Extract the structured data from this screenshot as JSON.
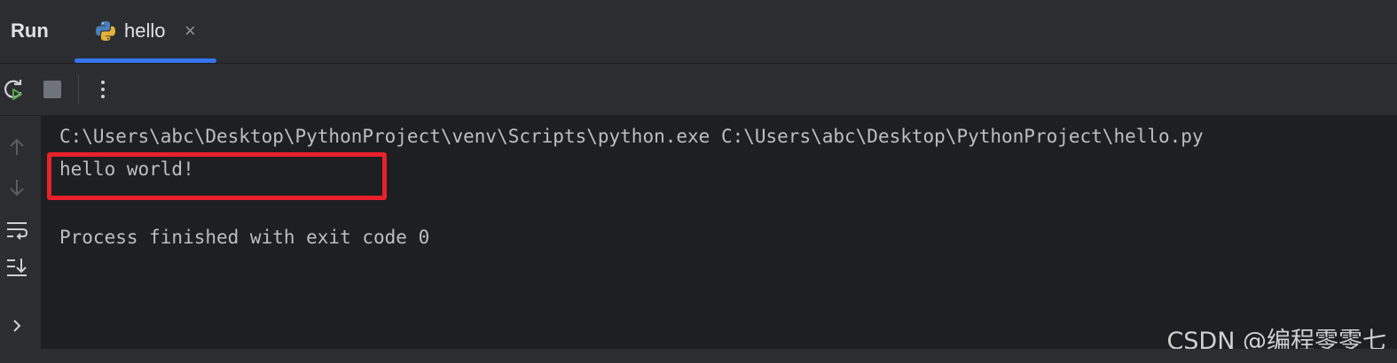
{
  "panel": {
    "title": "Run"
  },
  "tab": {
    "label": "hello",
    "close": "×",
    "icon": "python-icon"
  },
  "toolbar": {
    "rerun_icon": "rerun-icon",
    "stop_icon": "stop-icon",
    "more_icon": "more-vertical-icon"
  },
  "gutter": [
    "up-arrow-icon",
    "down-arrow-icon",
    "soft-wrap-icon",
    "scroll-to-end-icon",
    "chevron-right-icon"
  ],
  "console": {
    "command": "C:\\Users\\abc\\Desktop\\PythonProject\\venv\\Scripts\\python.exe C:\\Users\\abc\\Desktop\\PythonProject\\hello.py",
    "output": "hello world!",
    "exit": "Process finished with exit code 0"
  },
  "watermark": "CSDN @编程零零七",
  "colors": {
    "accent": "#3574f0",
    "highlight": "#e8212b",
    "console_bg": "#1e1f22",
    "panel_bg": "#2b2d30"
  }
}
